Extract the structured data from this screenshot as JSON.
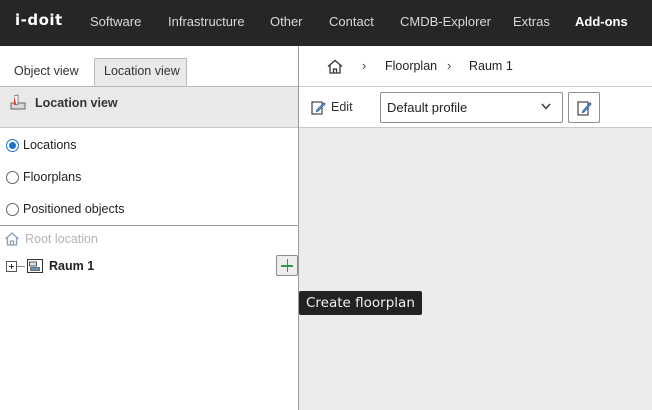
{
  "app": {
    "logo": "i-doit"
  },
  "nav": {
    "items": [
      {
        "label": "Software"
      },
      {
        "label": "Infrastructure"
      },
      {
        "label": "Other"
      },
      {
        "label": "Contact"
      },
      {
        "label": "CMDB-Explorer"
      },
      {
        "label": "Extras"
      },
      {
        "label": "Add-ons"
      }
    ],
    "active": "Add-ons"
  },
  "left_panel": {
    "tabs": [
      {
        "label": "Object view",
        "active": false
      },
      {
        "label": "Location view",
        "active": true
      }
    ],
    "header": {
      "title": "Location view",
      "icon": "location-view-icon"
    },
    "radios": [
      {
        "label": "Locations",
        "checked": true
      },
      {
        "label": "Floorplans",
        "checked": false
      },
      {
        "label": "Positioned objects",
        "checked": false
      }
    ],
    "tree": {
      "root_label": "Root location",
      "node_label": "Raum 1"
    }
  },
  "breadcrumb": {
    "items": [
      {
        "label": "Floorplan"
      },
      {
        "label": "Raum 1"
      }
    ]
  },
  "toolbar": {
    "edit_label": "Edit",
    "profile_select": {
      "value": "Default profile"
    }
  },
  "tooltip": {
    "text": "Create floorplan"
  },
  "colors": {
    "topbar_bg": "#262626",
    "panel_header_bg": "#e9e9e9",
    "canvas_bg": "#ececec",
    "radio_accent": "#1a73c9",
    "add_icon": "#2e9b3a"
  }
}
